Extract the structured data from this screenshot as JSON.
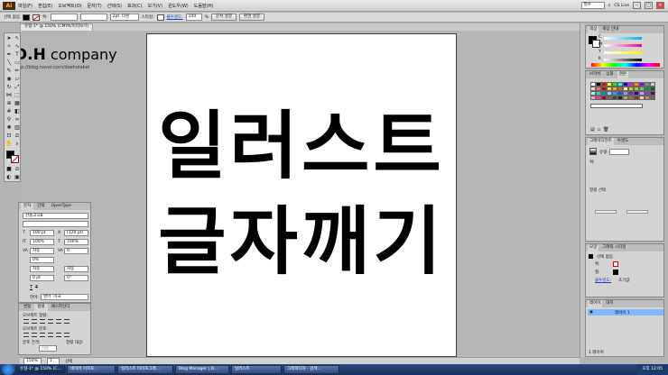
{
  "menubar": {
    "logo": "Ai",
    "menus": [
      "파일(F)",
      "편집(E)",
      "오브젝트(O)",
      "문자(T)",
      "선택(S)",
      "효과(C)",
      "보기(V)",
      "윈도우(W)",
      "도움말(H)"
    ],
    "search_value": "필수",
    "cs_live": "CS Live"
  },
  "controlbar": {
    "selection_label": "선택 없음",
    "stroke_label": "획:",
    "stroke_style": "2pt. 타원",
    "style_label": "스타일:",
    "opacity_label": "불투명도:",
    "opacity_value": "100",
    "doc_setup": "문서 설정",
    "prefs": "환경 설정"
  },
  "document": {
    "tab_title": "유형-1* @ 150% (CMYK/미리보기)"
  },
  "artboard": {
    "line1": "일러스트",
    "line2": "글자깨기"
  },
  "brand": {
    "name_prefix": "D.H",
    "name_suffix": "company",
    "url": "http://blog.naver.com/daeholabel"
  },
  "character_panel": {
    "tabs": [
      "문자",
      "단락",
      "OpenType"
    ],
    "font_family": "산돌고딕B",
    "font_size": "100 pt",
    "leading": "(120 pt)",
    "h_scale": "100%",
    "v_scale": "100%",
    "kerning_label": "자동",
    "tracking": "0",
    "baseline": "0%",
    "auto1": "자동",
    "auto2": "자동",
    "shift": "0 pt",
    "rotate": "0°",
    "lang_label": "언어:",
    "lang_value": "영어: 미국"
  },
  "paragraph_panel": {
    "tabs": [
      "변형",
      "정렬",
      "패스파인더"
    ],
    "align_objects_label": "오브젝트 정렬:",
    "distribute_label": "오브젝트 분포:",
    "spacing_label": "분포 간격:",
    "align_to_label": "정렬 대상:",
    "auto_label": "자동"
  },
  "color_panel": {
    "tabs": [
      "색상",
      "색상 안내"
    ],
    "channels": [
      "C",
      "M",
      "Y",
      "K"
    ]
  },
  "swatch_panel": {
    "tabs": [
      "브러쉬",
      "심볼",
      "견본"
    ],
    "colors": [
      "#ffffff",
      "#000000",
      "#ff0000",
      "#ffff00",
      "#00ff00",
      "#00ffff",
      "#0000ff",
      "#ff00ff",
      "#ff8800",
      "#8800ff",
      "#888888",
      "#cccccc",
      "#ffcccc",
      "#ff6666",
      "#cc0000",
      "#ffcc66",
      "#ff9933",
      "#cc6600",
      "#ffff99",
      "#cccc00",
      "#99cc33",
      "#66cc66",
      "#009933",
      "#006633",
      "#99ffcc",
      "#33cccc",
      "#009999",
      "#99ccff",
      "#3399ff",
      "#0066cc",
      "#9999ff",
      "#6633cc",
      "#330099",
      "#cc99ff",
      "#9933cc",
      "#660066",
      "#ff99cc",
      "#ff3399",
      "#990033",
      "#666666",
      "#444444",
      "#222222",
      "#c8a060",
      "#a07040",
      "#704020",
      "#e0d0b0",
      "#b09070",
      "#806040"
    ]
  },
  "gradient_panel": {
    "tabs": [
      "그레이디언트",
      "투명도"
    ],
    "type_label": "유형:",
    "stroke_label": "획:",
    "align_label": "정렬 선택"
  },
  "appearance_panel": {
    "tabs": [
      "모양",
      "그래픽 스타일"
    ],
    "selection": "선택 없음",
    "stroke_label": "획:",
    "fill_label": "칠:",
    "opacity_label": "불투명도:",
    "opacity_value": "초기값"
  },
  "layers_panel": {
    "tabs": [
      "레이어",
      "대지"
    ],
    "layer_name": "레이어 1",
    "footer": "1 레이어"
  },
  "statusbar": {
    "zoom": "150%",
    "page": "1",
    "tool": "선택"
  },
  "taskbar": {
    "tasks": [
      "유형-1* @ 150% (C...",
      "네이버 이지포...",
      "일러스트 타이포그래...",
      "Blog Manager | D...",
      "일러스트",
      "그래픽디자 - 검색..."
    ],
    "time": "오후 12:05"
  }
}
